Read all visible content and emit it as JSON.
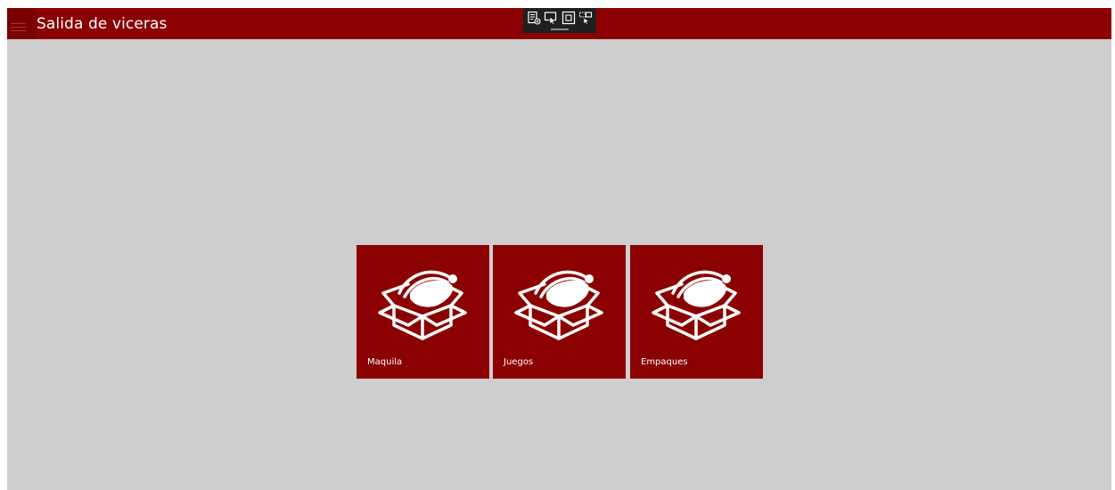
{
  "app": {
    "title": "Salida de viceras"
  },
  "toolbar": {
    "buttons": [
      {
        "icon": "live-visual-tree-icon"
      },
      {
        "icon": "select-element-icon"
      },
      {
        "icon": "display-layout-adorners-icon"
      },
      {
        "icon": "track-focused-element-icon"
      }
    ]
  },
  "tiles": [
    {
      "label": "Maquila",
      "icon": "open-box-icon"
    },
    {
      "label": "Juegos",
      "icon": "open-box-icon"
    },
    {
      "label": "Empaques",
      "icon": "open-box-icon"
    }
  ],
  "colors": {
    "accent": "#8b0000",
    "background": "#cecece",
    "toolbar": "#1f1f1f"
  }
}
